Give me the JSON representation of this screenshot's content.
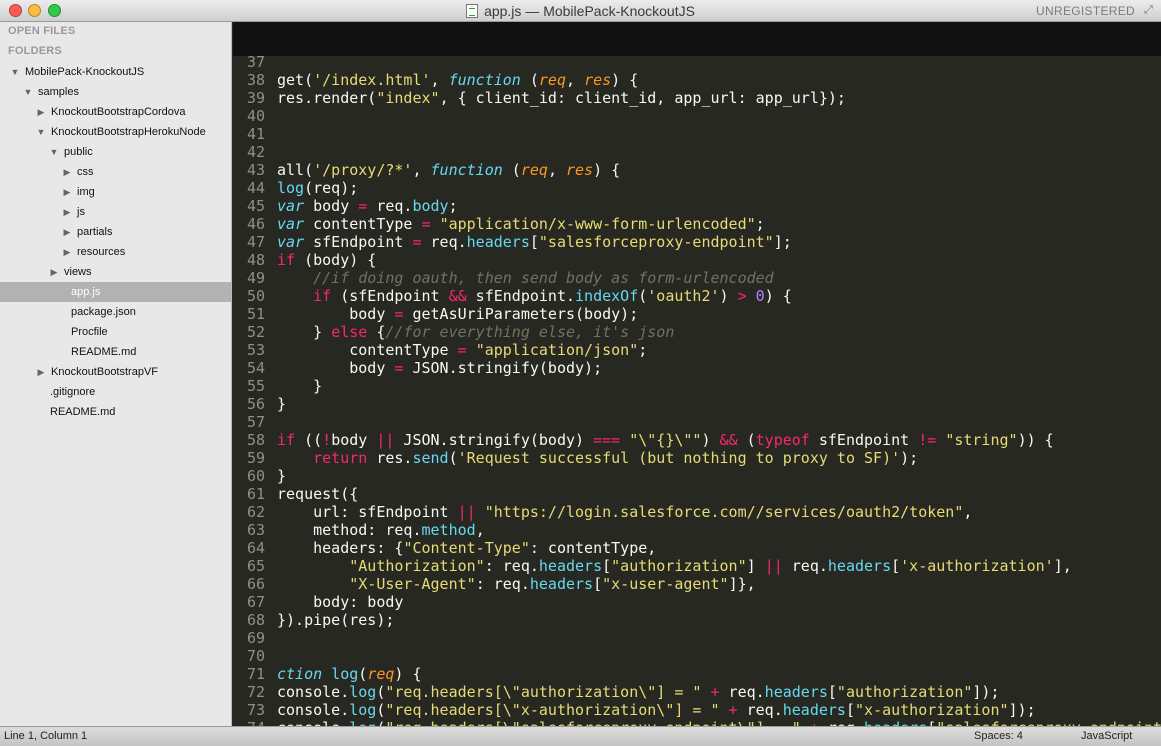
{
  "window": {
    "title": "app.js — MobilePack-KnockoutJS",
    "license_label": "UNREGISTERED"
  },
  "sidebar": {
    "open_files_header": "OPEN FILES",
    "folders_header": "FOLDERS",
    "tree": [
      {
        "label": "MobilePack-KnockoutJS",
        "depth": 0,
        "toggle": "open",
        "selected": false
      },
      {
        "label": "samples",
        "depth": 1,
        "toggle": "open",
        "selected": false
      },
      {
        "label": "KnockoutBootstrapCordova",
        "depth": 2,
        "toggle": "closed",
        "selected": false
      },
      {
        "label": "KnockoutBootstrapHerokuNode",
        "depth": 2,
        "toggle": "open",
        "selected": false
      },
      {
        "label": "public",
        "depth": 3,
        "toggle": "open",
        "selected": false
      },
      {
        "label": "css",
        "depth": 4,
        "toggle": "closed",
        "selected": false
      },
      {
        "label": "img",
        "depth": 4,
        "toggle": "closed",
        "selected": false
      },
      {
        "label": "js",
        "depth": 4,
        "toggle": "closed",
        "selected": false
      },
      {
        "label": "partials",
        "depth": 4,
        "toggle": "closed",
        "selected": false
      },
      {
        "label": "resources",
        "depth": 4,
        "toggle": "closed",
        "selected": false
      },
      {
        "label": "views",
        "depth": 3,
        "toggle": "closed",
        "selected": false
      },
      {
        "label": "app.js",
        "depth": 3,
        "toggle": "none",
        "selected": true
      },
      {
        "label": "package.json",
        "depth": 3,
        "toggle": "none",
        "selected": false
      },
      {
        "label": "Procfile",
        "depth": 3,
        "toggle": "none",
        "selected": false
      },
      {
        "label": "README.md",
        "depth": 3,
        "toggle": "none",
        "selected": false
      },
      {
        "label": "KnockoutBootstrapVF",
        "depth": 2,
        "toggle": "closed",
        "selected": false
      },
      {
        "label": ".gitignore",
        "depth": 1,
        "toggle": "none",
        "selected": false
      },
      {
        "label": "README.md",
        "depth": 1,
        "toggle": "none",
        "selected": false
      }
    ]
  },
  "editor": {
    "colors": {
      "background": "#272822",
      "text": "#f8f8f2",
      "keyword": "#f92672",
      "string": "#e6db74",
      "function": "#66d9ef",
      "parameter": "#fd971f",
      "comment": "#75715e",
      "number": "#ae81ff",
      "gutter": "#8f908a"
    },
    "lines": [
      {
        "n": "37",
        "tokens": []
      },
      {
        "n": "38",
        "tokens": [
          [
            "t",
            "get("
          ],
          [
            "s",
            "'/index.html'"
          ],
          [
            "t",
            ", "
          ],
          [
            "f",
            "function"
          ],
          [
            "t",
            " ("
          ],
          [
            "p",
            "req"
          ],
          [
            "t",
            ", "
          ],
          [
            "p",
            "res"
          ],
          [
            "t",
            ") {"
          ]
        ]
      },
      {
        "n": "39",
        "tokens": [
          [
            "t",
            "res.render("
          ],
          [
            "s",
            "\"index\""
          ],
          [
            "t",
            ", { client_id: client_id, app_url: app_url});"
          ]
        ]
      },
      {
        "n": "40",
        "tokens": []
      },
      {
        "n": "41",
        "tokens": []
      },
      {
        "n": "42",
        "tokens": []
      },
      {
        "n": "43",
        "tokens": [
          [
            "t",
            "all("
          ],
          [
            "s",
            "'/proxy/?*'"
          ],
          [
            "t",
            ", "
          ],
          [
            "f",
            "function"
          ],
          [
            "t",
            " ("
          ],
          [
            "p",
            "req"
          ],
          [
            "t",
            ", "
          ],
          [
            "p",
            "res"
          ],
          [
            "t",
            ") {"
          ]
        ]
      },
      {
        "n": "44",
        "tokens": [
          [
            "c",
            "log"
          ],
          [
            "t",
            "(req);"
          ]
        ]
      },
      {
        "n": "45",
        "tokens": [
          [
            "f",
            "var"
          ],
          [
            "t",
            " body "
          ],
          [
            "k",
            "="
          ],
          [
            "t",
            " req."
          ],
          [
            "c",
            "body"
          ],
          [
            "t",
            ";"
          ]
        ]
      },
      {
        "n": "46",
        "tokens": [
          [
            "f",
            "var"
          ],
          [
            "t",
            " contentType "
          ],
          [
            "k",
            "="
          ],
          [
            "t",
            " "
          ],
          [
            "s",
            "\"application/x-www-form-urlencoded\""
          ],
          [
            "t",
            ";"
          ]
        ]
      },
      {
        "n": "47",
        "tokens": [
          [
            "f",
            "var"
          ],
          [
            "t",
            " sfEndpoint "
          ],
          [
            "k",
            "="
          ],
          [
            "t",
            " req."
          ],
          [
            "c",
            "headers"
          ],
          [
            "t",
            "["
          ],
          [
            "s",
            "\"salesforceproxy-endpoint\""
          ],
          [
            "t",
            "];"
          ]
        ]
      },
      {
        "n": "48",
        "tokens": [
          [
            "k",
            "if"
          ],
          [
            "t",
            " (body) {"
          ]
        ]
      },
      {
        "n": "49",
        "tokens": [
          [
            "t",
            "    "
          ],
          [
            "m",
            "//if doing oauth, then send body as form-urlencoded"
          ]
        ]
      },
      {
        "n": "50",
        "tokens": [
          [
            "t",
            "    "
          ],
          [
            "k",
            "if"
          ],
          [
            "t",
            " (sfEndpoint "
          ],
          [
            "k",
            "&&"
          ],
          [
            "t",
            " sfEndpoint."
          ],
          [
            "c",
            "indexOf"
          ],
          [
            "t",
            "("
          ],
          [
            "s",
            "'oauth2'"
          ],
          [
            "t",
            ") "
          ],
          [
            "k",
            ">"
          ],
          [
            "t",
            " "
          ],
          [
            "n",
            "0"
          ],
          [
            "t",
            ") {"
          ]
        ]
      },
      {
        "n": "51",
        "tokens": [
          [
            "t",
            "        body "
          ],
          [
            "k",
            "="
          ],
          [
            "t",
            " getAsUriParameters(body);"
          ]
        ]
      },
      {
        "n": "52",
        "tokens": [
          [
            "t",
            "    } "
          ],
          [
            "k",
            "else"
          ],
          [
            "t",
            " {"
          ],
          [
            "m",
            "//for everything else, it's json"
          ]
        ]
      },
      {
        "n": "53",
        "tokens": [
          [
            "t",
            "        contentType "
          ],
          [
            "k",
            "="
          ],
          [
            "t",
            " "
          ],
          [
            "s",
            "\"application/json\""
          ],
          [
            "t",
            ";"
          ]
        ]
      },
      {
        "n": "54",
        "tokens": [
          [
            "t",
            "        body "
          ],
          [
            "k",
            "="
          ],
          [
            "t",
            " JSON.stringify(body);"
          ]
        ]
      },
      {
        "n": "55",
        "tokens": [
          [
            "t",
            "    }"
          ]
        ]
      },
      {
        "n": "56",
        "tokens": [
          [
            "t",
            "}"
          ]
        ]
      },
      {
        "n": "57",
        "tokens": []
      },
      {
        "n": "58",
        "tokens": [
          [
            "k",
            "if"
          ],
          [
            "t",
            " (("
          ],
          [
            "k",
            "!"
          ],
          [
            "t",
            "body "
          ],
          [
            "k",
            "||"
          ],
          [
            "t",
            " JSON.stringify(body) "
          ],
          [
            "k",
            "==="
          ],
          [
            "t",
            " "
          ],
          [
            "s",
            "\"\\\"{}\\\"\""
          ],
          [
            "t",
            ") "
          ],
          [
            "k",
            "&&"
          ],
          [
            "t",
            " ("
          ],
          [
            "k",
            "typeof"
          ],
          [
            "t",
            " sfEndpoint "
          ],
          [
            "k",
            "!="
          ],
          [
            "t",
            " "
          ],
          [
            "s",
            "\"string\""
          ],
          [
            "t",
            ")) {"
          ]
        ]
      },
      {
        "n": "59",
        "tokens": [
          [
            "t",
            "    "
          ],
          [
            "k",
            "return"
          ],
          [
            "t",
            " res."
          ],
          [
            "c",
            "send"
          ],
          [
            "t",
            "("
          ],
          [
            "s",
            "'Request successful (but nothing to proxy to SF)'"
          ],
          [
            "t",
            ");"
          ]
        ]
      },
      {
        "n": "60",
        "tokens": [
          [
            "t",
            "}"
          ]
        ]
      },
      {
        "n": "61",
        "tokens": [
          [
            "t",
            "request({"
          ]
        ]
      },
      {
        "n": "62",
        "tokens": [
          [
            "t",
            "    url: sfEndpoint "
          ],
          [
            "k",
            "||"
          ],
          [
            "t",
            " "
          ],
          [
            "s",
            "\"https://login.salesforce.com//services/oauth2/token\""
          ],
          [
            "t",
            ","
          ]
        ]
      },
      {
        "n": "63",
        "tokens": [
          [
            "t",
            "    method: req."
          ],
          [
            "c",
            "method"
          ],
          [
            "t",
            ","
          ]
        ]
      },
      {
        "n": "64",
        "tokens": [
          [
            "t",
            "    headers: {"
          ],
          [
            "s",
            "\"Content-Type\""
          ],
          [
            "t",
            ": contentType,"
          ]
        ]
      },
      {
        "n": "65",
        "tokens": [
          [
            "t",
            "        "
          ],
          [
            "s",
            "\"Authorization\""
          ],
          [
            "t",
            ": req."
          ],
          [
            "c",
            "headers"
          ],
          [
            "t",
            "["
          ],
          [
            "s",
            "\"authorization\""
          ],
          [
            "t",
            "] "
          ],
          [
            "k",
            "||"
          ],
          [
            "t",
            " req."
          ],
          [
            "c",
            "headers"
          ],
          [
            "t",
            "["
          ],
          [
            "s",
            "'x-authorization'"
          ],
          [
            "t",
            "],"
          ]
        ]
      },
      {
        "n": "66",
        "tokens": [
          [
            "t",
            "        "
          ],
          [
            "s",
            "\"X-User-Agent\""
          ],
          [
            "t",
            ": req."
          ],
          [
            "c",
            "headers"
          ],
          [
            "t",
            "["
          ],
          [
            "s",
            "\"x-user-agent\""
          ],
          [
            "t",
            "]},"
          ]
        ]
      },
      {
        "n": "67",
        "tokens": [
          [
            "t",
            "    body: body"
          ]
        ]
      },
      {
        "n": "68",
        "tokens": [
          [
            "t",
            "}).pipe(res);"
          ]
        ]
      },
      {
        "n": "69",
        "tokens": []
      },
      {
        "n": "70",
        "tokens": []
      },
      {
        "n": "71",
        "tokens": [
          [
            "f",
            "ction"
          ],
          [
            "t",
            " "
          ],
          [
            "c",
            "log"
          ],
          [
            "t",
            "("
          ],
          [
            "p",
            "req"
          ],
          [
            "t",
            ") {"
          ]
        ]
      },
      {
        "n": "72",
        "tokens": [
          [
            "t",
            "console."
          ],
          [
            "c",
            "log"
          ],
          [
            "t",
            "("
          ],
          [
            "s",
            "\"req.headers[\\\"authorization\\\"] = \""
          ],
          [
            "t",
            " "
          ],
          [
            "k",
            "+"
          ],
          [
            "t",
            " req."
          ],
          [
            "c",
            "headers"
          ],
          [
            "t",
            "["
          ],
          [
            "s",
            "\"authorization\""
          ],
          [
            "t",
            "]);"
          ]
        ]
      },
      {
        "n": "73",
        "tokens": [
          [
            "t",
            "console."
          ],
          [
            "c",
            "log"
          ],
          [
            "t",
            "("
          ],
          [
            "s",
            "\"req.headers[\\\"x-authorization\\\"] = \""
          ],
          [
            "t",
            " "
          ],
          [
            "k",
            "+"
          ],
          [
            "t",
            " req."
          ],
          [
            "c",
            "headers"
          ],
          [
            "t",
            "["
          ],
          [
            "s",
            "\"x-authorization\""
          ],
          [
            "t",
            "]);"
          ]
        ]
      },
      {
        "n": "74",
        "tokens": [
          [
            "t",
            "console."
          ],
          [
            "c",
            "log"
          ],
          [
            "t",
            "("
          ],
          [
            "s",
            "\"req.headers[\\\"salesforceproxy-endpoint\\\"] = \""
          ],
          [
            "t",
            " "
          ],
          [
            "k",
            "+"
          ],
          [
            "t",
            " req."
          ],
          [
            "c",
            "headers"
          ],
          [
            "t",
            "["
          ],
          [
            "s",
            "\"salesforceproxy-endpoint"
          ]
        ]
      }
    ]
  },
  "statusbar": {
    "cursor_position": "Line 1, Column 1",
    "indentation": "Spaces: 4",
    "syntax": "JavaScript"
  }
}
